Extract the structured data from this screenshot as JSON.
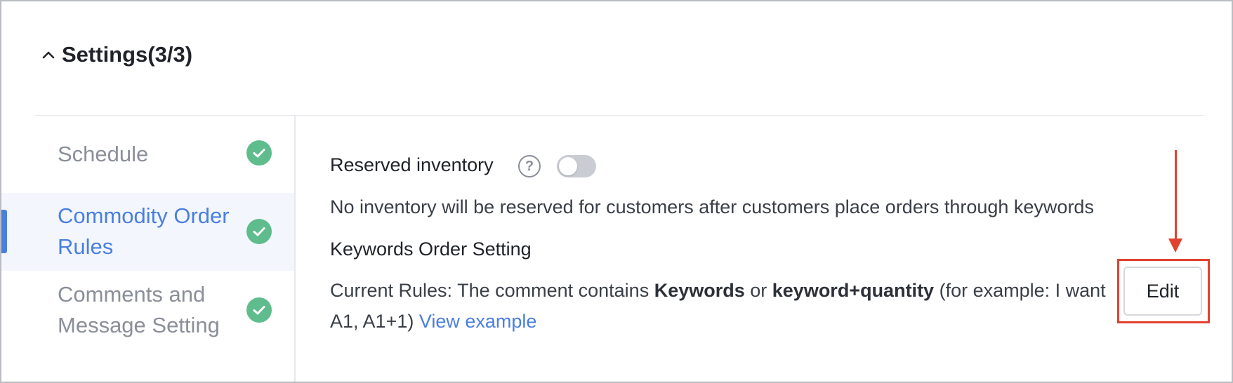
{
  "section": {
    "title": "Settings(3/3)",
    "expand_icon": "chevron-up-icon"
  },
  "sidebar": {
    "items": [
      {
        "label": "Schedule",
        "status_icon": "check-circle-icon",
        "active": false
      },
      {
        "label": "Commodity Order Rules",
        "status_icon": "check-circle-icon",
        "active": true
      },
      {
        "label": "Comments and Message Setting",
        "status_icon": "check-circle-icon",
        "active": false
      }
    ]
  },
  "main": {
    "reserved_inventory": {
      "label": "Reserved inventory",
      "help_icon": "question-circle-icon",
      "help_glyph": "?",
      "toggle_on": false,
      "description": "No inventory will be reserved for customers after customers place orders through keywords"
    },
    "keywords_order": {
      "heading": "Keywords Order Setting",
      "rules_prefix": "Current Rules: The comment contains ",
      "keyword_bold": "Keywords",
      "or_text": " or ",
      "keyword_qty_bold": "keyword+quantity",
      "rules_suffix": " (for example: I want A1, A1+1) ",
      "view_example_link": "View example",
      "edit_label": "Edit"
    }
  },
  "colors": {
    "accent": "#4a7fe0",
    "success": "#5fbc8c",
    "annotation": "#e1412e",
    "toggle_off": "#c9ccd2"
  }
}
